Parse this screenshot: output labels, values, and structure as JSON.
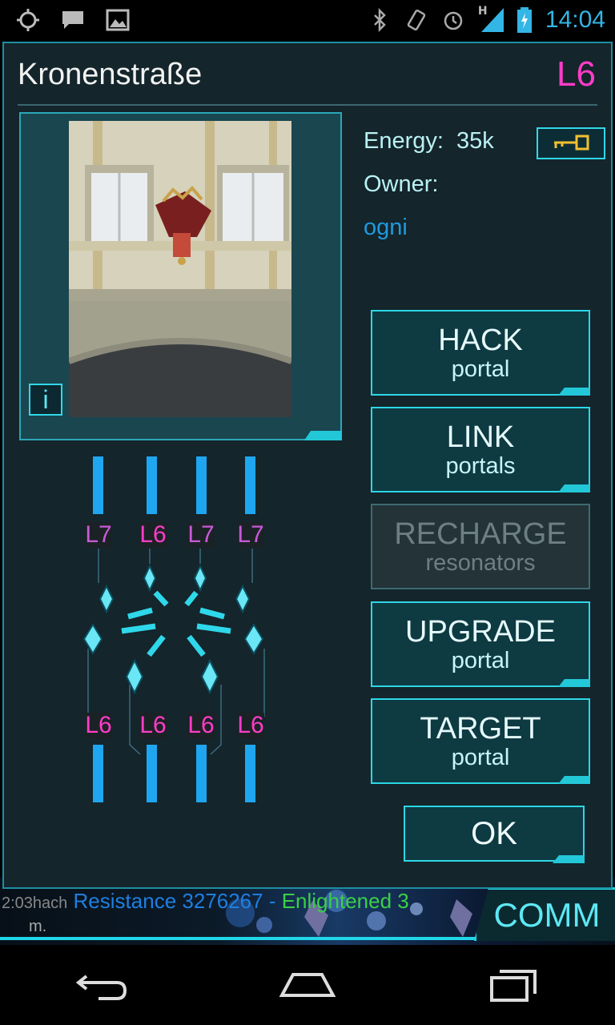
{
  "status_bar": {
    "time": "14:04",
    "network_label": "H",
    "icons_left": [
      "gps-icon",
      "message-icon",
      "image-icon"
    ],
    "icons_right": [
      "bluetooth-icon",
      "vibrate-icon",
      "alarm-icon",
      "signal-icon",
      "battery-icon"
    ]
  },
  "portal": {
    "name": "Kronenstraße",
    "level": "L6",
    "energy_label": "Energy:",
    "energy_value": "35k",
    "owner_label": "Owner:",
    "owner_name": "ogni",
    "info_label": "i"
  },
  "resonators": {
    "top_levels": [
      "L7",
      "L6",
      "L7",
      "L7"
    ],
    "bottom_levels": [
      "L6",
      "L6",
      "L6",
      "L6"
    ],
    "top_fill": [
      1,
      1,
      1,
      1
    ],
    "bottom_fill": [
      1,
      1,
      1,
      1
    ]
  },
  "actions": [
    {
      "line1": "HACK",
      "line2": "portal",
      "enabled": true
    },
    {
      "line1": "LINK",
      "line2": "portals",
      "enabled": true
    },
    {
      "line1": "RECHARGE",
      "line2": "resonators",
      "enabled": false
    },
    {
      "line1": "UPGRADE",
      "line2": "portal",
      "enabled": true
    },
    {
      "line1": "TARGET",
      "line2": "portal",
      "enabled": true
    }
  ],
  "ok_label": "OK",
  "comm": {
    "button_label": "COMM",
    "timestamp_text": "2:03hach",
    "message_resistance": "Resistance 3276267",
    "message_separator": " - ",
    "message_enlightened": "Enlightened 3",
    "line2_text": "m."
  },
  "colors": {
    "accent": "#2cd7e6",
    "level_magenta": "#ff3cc8",
    "level_purple": "#c95ad8",
    "owner_blue": "#1e9ae0",
    "resistance_blue": "#1e7fe0",
    "enlightened_green": "#3ad046"
  }
}
